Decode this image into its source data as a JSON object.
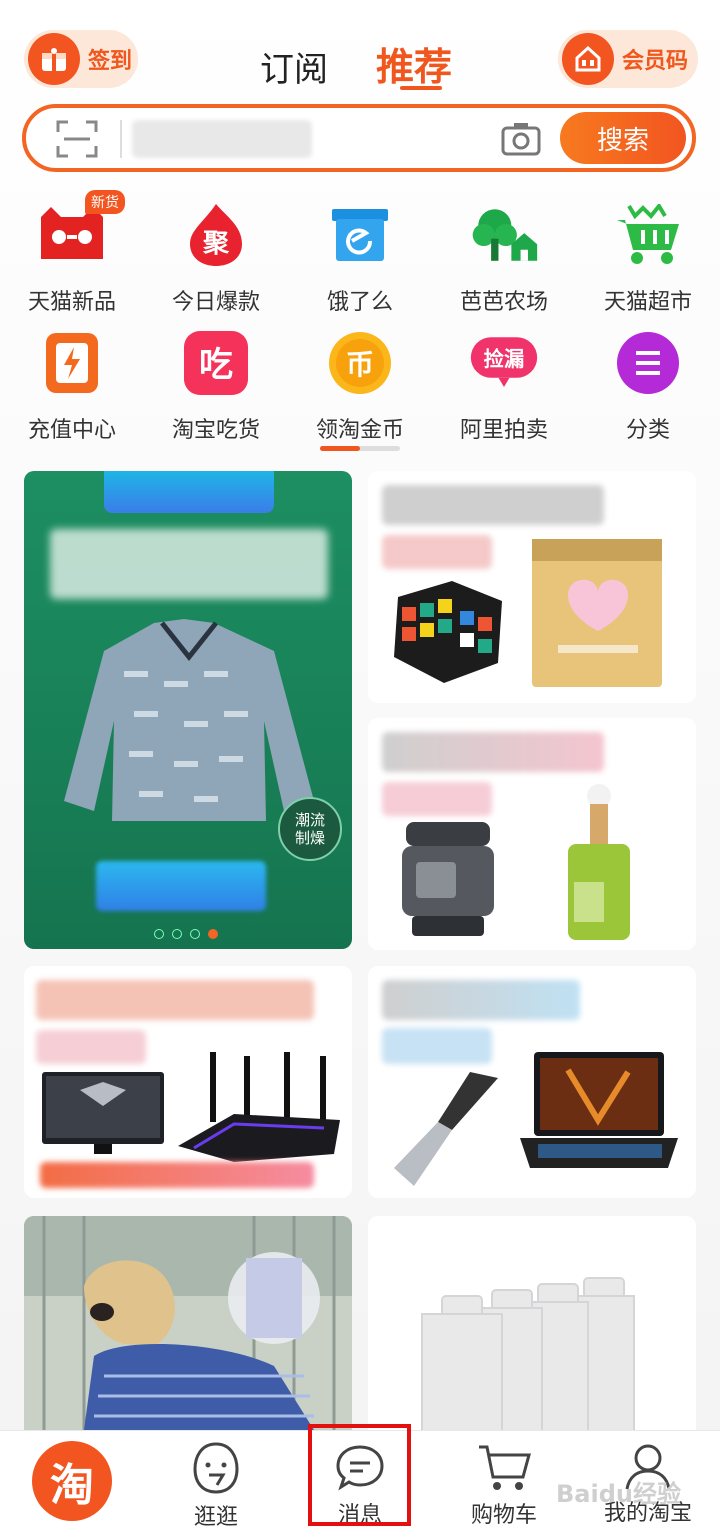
{
  "header": {
    "signin_label": "签到",
    "tabs": [
      {
        "label": "订阅"
      },
      {
        "label": "推荐"
      }
    ],
    "member_label": "会员码"
  },
  "search": {
    "button_label": "搜索",
    "scan_icon": "scan-icon",
    "camera_icon": "camera-icon"
  },
  "shortcuts": {
    "row1": [
      {
        "label": "天猫新品",
        "icon": "tmall-cat-icon",
        "badge": "新货"
      },
      {
        "label": "今日爆款",
        "icon": "ju-flame-icon",
        "glyph": "聚"
      },
      {
        "label": "饿了么",
        "icon": "eleme-box-icon"
      },
      {
        "label": "芭芭农场",
        "icon": "farm-tree-icon"
      },
      {
        "label": "天猫超市",
        "icon": "shopping-cart-icon"
      }
    ],
    "row2": [
      {
        "label": "充值中心",
        "icon": "phone-bolt-icon"
      },
      {
        "label": "淘宝吃货",
        "icon": "chi-food-icon",
        "glyph": "吃"
      },
      {
        "label": "领淘金币",
        "icon": "gold-coin-icon",
        "glyph": "币"
      },
      {
        "label": "阿里拍卖",
        "icon": "auction-icon",
        "glyph": "捡漏"
      },
      {
        "label": "分类",
        "icon": "category-menu-icon"
      }
    ]
  },
  "feed": {
    "banner_tag": "潮流\n制燥"
  },
  "bottom_nav": [
    {
      "label": "",
      "icon": "taobao-logo-icon",
      "glyph": "淘"
    },
    {
      "label": "逛逛",
      "icon": "guangguang-face-icon"
    },
    {
      "label": "消息",
      "icon": "message-bubble-icon"
    },
    {
      "label": "购物车",
      "icon": "cart-icon"
    },
    {
      "label": "我的淘宝",
      "icon": "user-icon"
    }
  ],
  "watermark": "Baidu经验",
  "colors": {
    "accent": "#f0571e",
    "highlight_box": "#e31010",
    "banner_green": "#1c8a5a"
  }
}
